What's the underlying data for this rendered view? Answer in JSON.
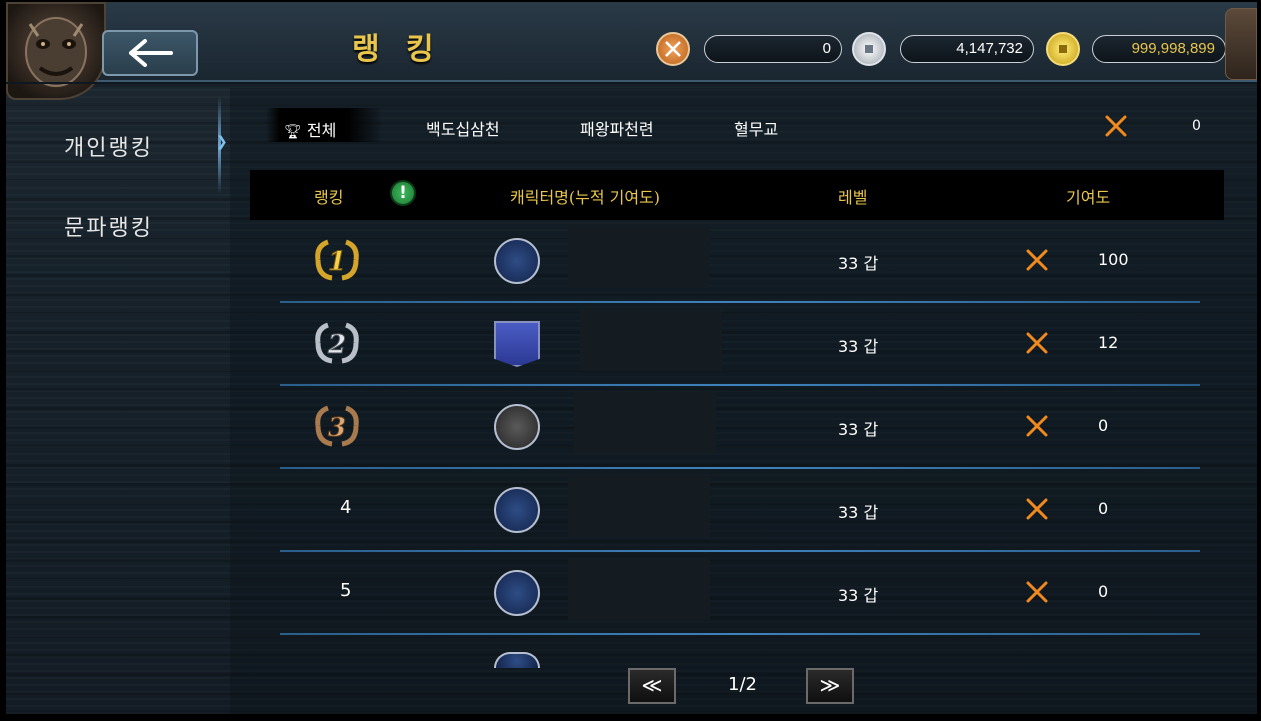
{
  "header": {
    "title": "랭 킹",
    "currencies": [
      {
        "icon": "crossed-swords-coin-icon",
        "value": "0"
      },
      {
        "icon": "silver-coin-icon",
        "value": "4,147,732"
      },
      {
        "icon": "gold-coin-icon",
        "value": "999,998,899"
      }
    ]
  },
  "sidebar": {
    "items": [
      {
        "label": "개인랭킹",
        "active": true
      },
      {
        "label": "문파랭킹",
        "active": false
      }
    ]
  },
  "tabs": [
    {
      "label": "전체",
      "active": true
    },
    {
      "label": "백도십삼천",
      "active": false
    },
    {
      "label": "패왕파천련",
      "active": false
    },
    {
      "label": "혈무교",
      "active": false
    }
  ],
  "my_score": "0",
  "table": {
    "columns": [
      "랭킹",
      "캐릭터명(누적 기여도)",
      "레벨",
      "기여도"
    ],
    "rows": [
      {
        "rank": "1",
        "emblem": "blue-dragon-emblem",
        "level": "33 갑",
        "contribution": "100"
      },
      {
        "rank": "2",
        "emblem": "blue-banner-emblem",
        "level": "33 갑",
        "contribution": "12"
      },
      {
        "rank": "3",
        "emblem": "dark-skull-emblem",
        "level": "33 갑",
        "contribution": "0"
      },
      {
        "rank": "4",
        "emblem": "blue-dragon-emblem",
        "level": "33 갑",
        "contribution": "0"
      },
      {
        "rank": "5",
        "emblem": "blue-dragon-emblem",
        "level": "33 갑",
        "contribution": "0"
      }
    ]
  },
  "pager": {
    "prev": "≪",
    "indicator": "1/2",
    "next": "≫"
  },
  "colors": {
    "gold": "#e9c64b",
    "separator": "#3e82bd",
    "contribution_icon": "#f08a1e"
  }
}
